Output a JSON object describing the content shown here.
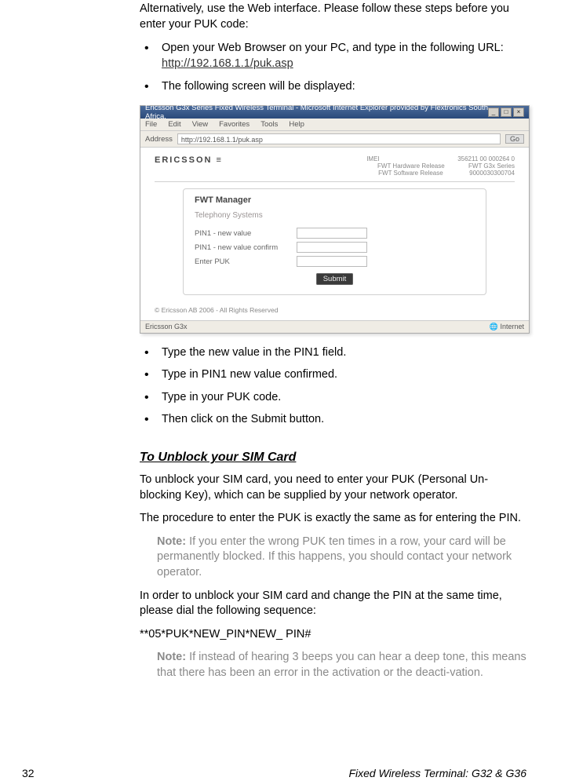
{
  "intro1": "Alternatively, use the Web interface.  Please follow these steps before you enter your PUK code:",
  "bullets_a": {
    "b1_pre": "Open your Web Browser on your PC, and type in the following URL: ",
    "b1_url": "http://192.168.1.1/puk.asp",
    "b2": "The following screen will be displayed:"
  },
  "browser": {
    "title": "Ericsson G3x Series Fixed Wireless Terminal - Microsoft Internet Explorer provided by Flextronics South Africa.",
    "menu": {
      "file": "File",
      "edit": "Edit",
      "view": "View",
      "favorites": "Favorites",
      "tools": "Tools",
      "help": "Help"
    },
    "addr_label": "Address",
    "addr_value": "http://192.168.1.1/puk.asp",
    "go": "Go",
    "brand": "ERICSSON",
    "info": {
      "imei_label": "IMEI",
      "imei_val": "356211 00 000264 0",
      "hw_label": "FWT Hardware Release",
      "hw_val": "FWT G3x Series",
      "sw_label": "FWT Software Release",
      "sw_val": "9000030300704"
    },
    "panel_title": "FWT Manager",
    "panel_sub": "Telephony Systems",
    "fields": {
      "pin1_new": "PIN1 - new value",
      "pin1_confirm": "PIN1 - new value confirm",
      "enter_puk": "Enter PUK"
    },
    "submit": "Submit",
    "copyright": "© Ericsson AB 2006 - All Rights Reserved",
    "status_left": "Ericsson G3x",
    "status_right": "Internet"
  },
  "bullets_b": {
    "b1": "Type the new value in the PIN1 field.",
    "b2": "Type in PIN1 new value confirmed.",
    "b3": "Type in your PUK code.",
    "b4": "Then click on the Submit button."
  },
  "section_heading": "To Unblock your SIM Card",
  "p1": "To unblock your SIM card, you need to enter your PUK (Personal Un-blocking Key), which can be supplied by your network operator.",
  "p2": "The procedure to enter the PUK is exactly the same as for entering the PIN.",
  "note1_label": "Note:",
  "note1_text": " If you enter the wrong PUK ten times in a row, your card will be permanently blocked. If this happens, you should contact your network operator.",
  "p3": "In order to unblock your SIM card and change the PIN at the same time, please dial the following sequence:",
  "sequence": "**05*PUK*NEW_PIN*NEW_ PIN#",
  "note2_label": "Note:",
  "note2_text": " If instead of hearing 3 beeps you can hear a deep tone, this means that there has been an error in the activation or the deacti-vation.",
  "footer": {
    "page": "32",
    "title": "Fixed Wireless Terminal: G32 & G36"
  }
}
